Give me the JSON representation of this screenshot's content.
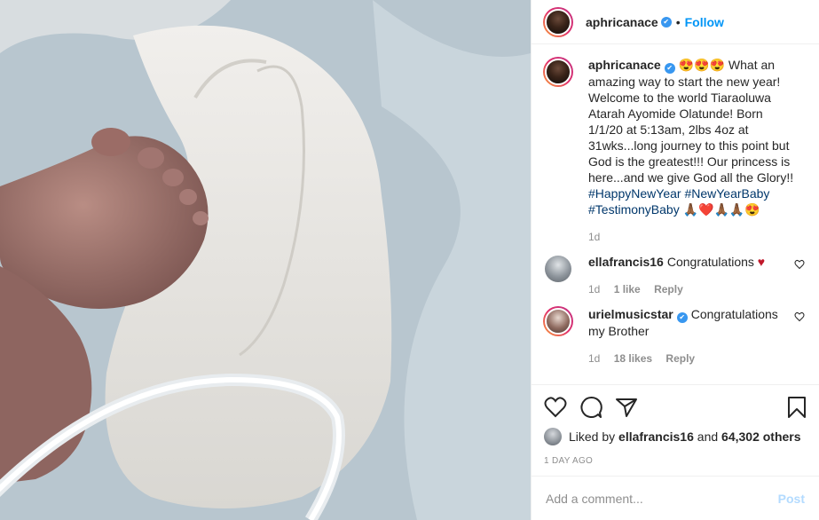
{
  "header": {
    "username": "aphricanace",
    "separator": "•",
    "follow_label": "Follow"
  },
  "caption": {
    "username": "aphricanace",
    "text": "😍😍😍 What an amazing way to start the new year! Welcome to the world Tiaraoluwa Atarah Ayomide Olatunde! Born 1/1/20 at 5:13am, 2lbs 4oz at 31wks...long journey to this point but God is the greatest!!! Our princess is here...and we give God all the Glory!! ",
    "hashtags": "#HappyNewYear #NewYearBaby #TestimonyBaby",
    "emoji_tail": " 🙏🏾❤️🙏🏾🙏🏾😍",
    "age": "1d"
  },
  "comments": [
    {
      "username": "ellafrancis16",
      "text": "Congratulations",
      "heart": "♥",
      "age": "1d",
      "likes": "1 like",
      "reply": "Reply"
    },
    {
      "username": "urielmusicstar",
      "text": "Congratulations my Brother",
      "age": "1d",
      "likes": "18 likes",
      "reply": "Reply"
    }
  ],
  "likes": {
    "prefix": "Liked by",
    "user": "ellafrancis16",
    "middle": "and",
    "others": "64,302 others"
  },
  "date": "1 DAY AGO",
  "add_comment": {
    "placeholder": "Add a comment...",
    "post_label": "Post"
  },
  "colors": {
    "link": "#0095f6",
    "verified": "#3897f0",
    "heart": "#c0182a",
    "muted": "#8e8e8e",
    "post_disabled": "#b3dbff"
  }
}
